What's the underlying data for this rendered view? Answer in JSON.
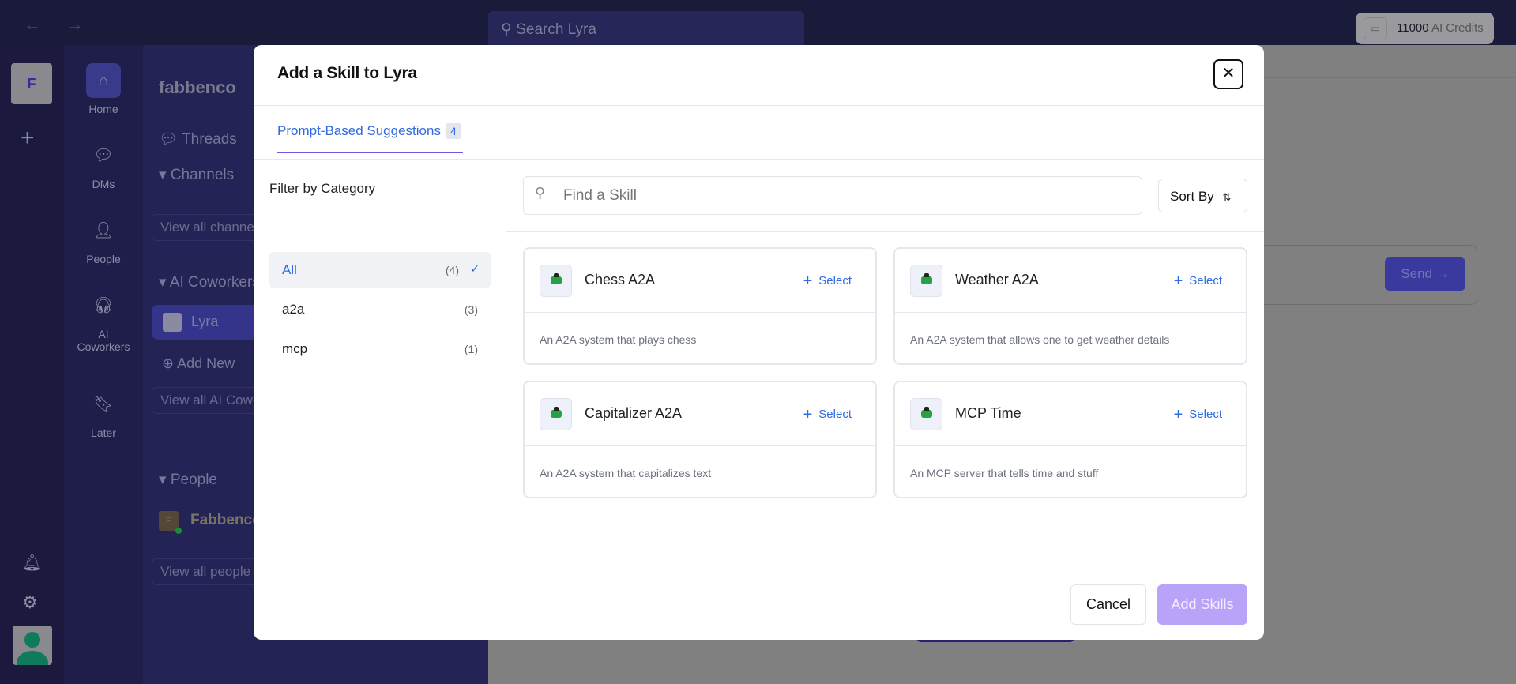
{
  "topbar": {
    "back_icon": "arrow-left-icon",
    "forward_icon": "arrow-right-icon",
    "search_placeholder": "Search Lyra",
    "credits_amount": "11000",
    "credits_label": "AI Credits"
  },
  "workspace": {
    "initial": "F"
  },
  "rail": {
    "items": [
      {
        "label": "Home",
        "icon": "home-icon"
      },
      {
        "label": "DMs",
        "icon": "chat-icon"
      },
      {
        "label": "People",
        "icon": "person-icon"
      },
      {
        "label": "AI Coworkers",
        "icon": "headset-icon"
      },
      {
        "label": "Later",
        "icon": "bookmark-icon"
      }
    ]
  },
  "sidebar": {
    "workspace_name": "fabbenco",
    "threads": "Threads",
    "channels": "Channels",
    "view_all_channels": "View all channels",
    "ai_coworkers": "AI Coworkers",
    "lyra": "Lyra",
    "add_new": "Add New",
    "view_all_ai": "View all AI Coworkers",
    "people": "People",
    "person_initial": "F",
    "person_name": "Fabbenco",
    "view_all_people": "View all people"
  },
  "main": {
    "send_label": "Send"
  },
  "modal": {
    "title": "Add a Skill to Lyra",
    "tab": {
      "label": "Prompt-Based Suggestions",
      "count": "4"
    },
    "filter_heading": "Filter by Category",
    "categories": [
      {
        "label": "All",
        "count": "(4)",
        "selected": true
      },
      {
        "label": "a2a",
        "count": "(3)"
      },
      {
        "label": "mcp",
        "count": "(1)"
      }
    ],
    "search_placeholder": "Find a Skill",
    "sort_label": "Sort By",
    "select_label": "Select",
    "skills": [
      {
        "name": "Chess A2A",
        "description": "An A2A system that plays chess"
      },
      {
        "name": "Weather A2A",
        "description": "An A2A system that allows one to get weather details"
      },
      {
        "name": "Capitalizer A2A",
        "description": "An A2A system that capitalizes text"
      },
      {
        "name": "MCP Time",
        "description": "An MCP server that tells time and stuff"
      }
    ],
    "cancel_label": "Cancel",
    "add_label": "Add Skills",
    "colors": {
      "accent": "#2f6be0",
      "tab_underline": "#6b5ce7",
      "add_button": "#b9a3f8"
    }
  }
}
